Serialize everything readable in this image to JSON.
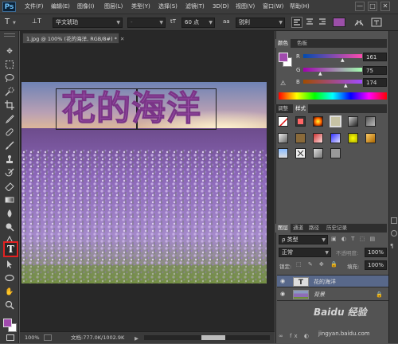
{
  "app": {
    "logo": "Ps"
  },
  "menu": [
    "文件(F)",
    "编辑(E)",
    "图像(I)",
    "图层(L)",
    "类型(Y)",
    "选择(S)",
    "滤镜(T)",
    "3D(D)",
    "视图(V)",
    "窗口(W)",
    "帮助(H)"
  ],
  "window_buttons": [
    "—",
    "□",
    "✕"
  ],
  "options_bar": {
    "tool_glyph": "T",
    "orient_glyph": "⊥T",
    "font_family": "华文琥珀",
    "font_style": "-",
    "size_glyph": "tT",
    "font_size": "60 点",
    "aa_glyph": "aa",
    "antialias": "锐利",
    "text_color": "#9b4fa8"
  },
  "document": {
    "tab_title": "1.jpg @ 100% (花的海洋, RGB/8#) *",
    "canvas_text": "花的海洋",
    "text_color": "#9b4fa8"
  },
  "status": {
    "zoom": "100%",
    "doc_info": "文档:777.0K/1002.9K"
  },
  "color_panel": {
    "tabs": [
      "颜色",
      "色板"
    ],
    "channels": [
      {
        "label": "R",
        "value": "161"
      },
      {
        "label": "G",
        "value": "75"
      },
      {
        "label": "B",
        "value": "174"
      }
    ],
    "fg_color": "#a14bae"
  },
  "styles_panel": {
    "tabs": [
      "调整",
      "样式"
    ]
  },
  "layers_panel": {
    "tabs": [
      "图层",
      "通道",
      "路径",
      "历史记录"
    ],
    "kind_label": "ρ 类型",
    "blend_mode": "正常",
    "opacity_label": "不透明度:",
    "opacity": "100%",
    "lock_label": "锁定:",
    "fill_label": "填充:",
    "fill": "100%",
    "layers": [
      {
        "name": "花的海洋",
        "type": "T"
      },
      {
        "name": "背景",
        "type": "image"
      }
    ]
  },
  "watermark": {
    "site": "Baidu 经验",
    "url": "jingyan.baidu.com"
  }
}
